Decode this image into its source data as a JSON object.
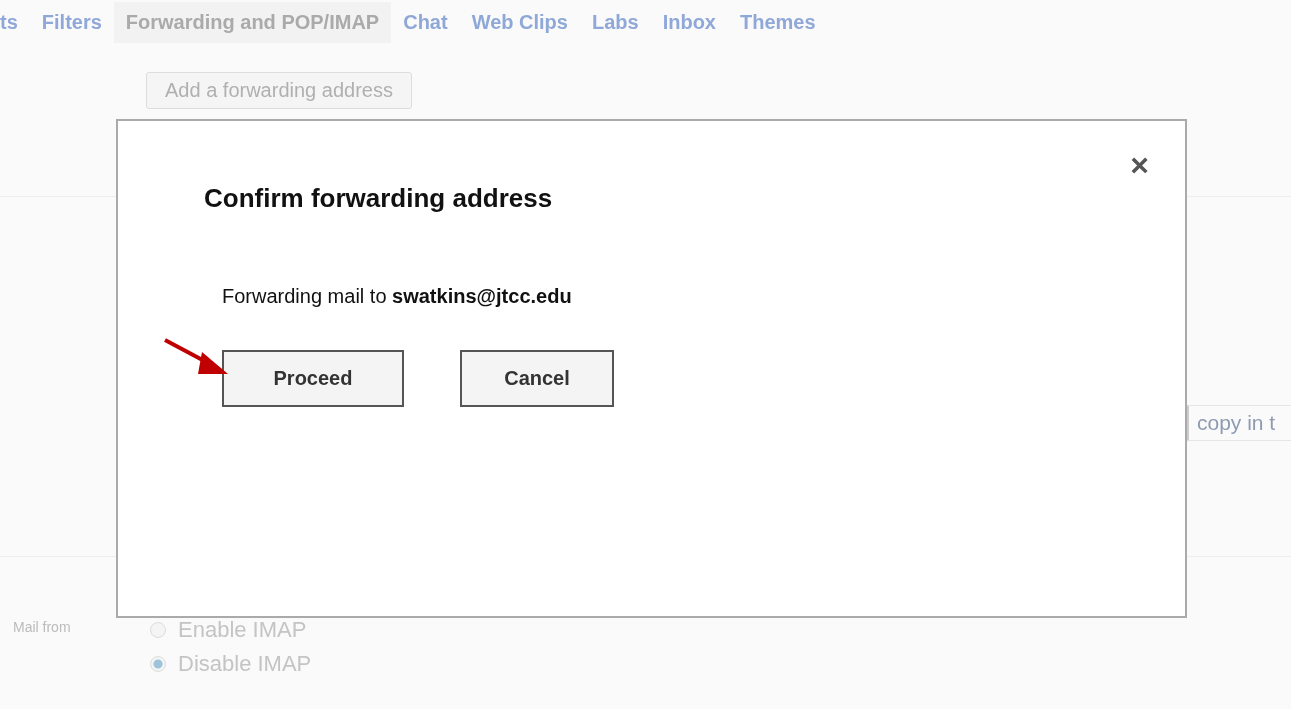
{
  "tabs": [
    {
      "label": "ts",
      "selected": false
    },
    {
      "label": "Filters",
      "selected": false
    },
    {
      "label": "Forwarding and POP/IMAP",
      "selected": true
    },
    {
      "label": "Chat",
      "selected": false
    },
    {
      "label": "Web Clips",
      "selected": false
    },
    {
      "label": "Labs",
      "selected": false
    },
    {
      "label": "Inbox",
      "selected": false
    },
    {
      "label": "Themes",
      "selected": false
    }
  ],
  "add_button": "Add a forwarding address",
  "copy_field": "copy in t",
  "imap": {
    "label": "Mail from",
    "options": [
      {
        "label": "Enable IMAP",
        "selected": false
      },
      {
        "label": "Disable IMAP",
        "selected": true
      }
    ]
  },
  "dialog": {
    "close": "×",
    "title": "Confirm forwarding address",
    "message": "Forwarding mail to **swatkins@jtcc.edu**",
    "buttons": [
      "Proceed",
      "Cancel"
    ]
  }
}
